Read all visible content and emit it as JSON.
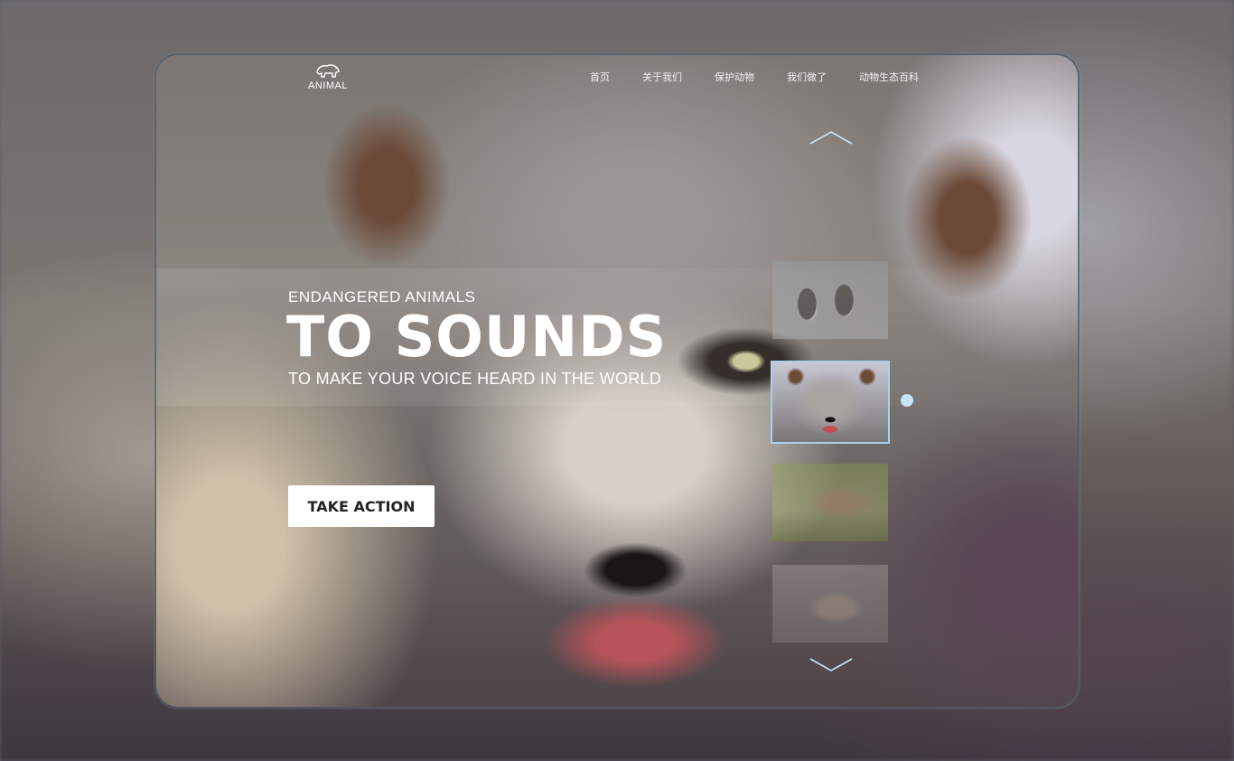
{
  "brand": {
    "name": "ANIMAL"
  },
  "nav": [
    {
      "label": "首页"
    },
    {
      "label": "关于我们"
    },
    {
      "label": "保护动物"
    },
    {
      "label": "我们做了"
    },
    {
      "label": "动物生态百科"
    }
  ],
  "hero": {
    "eyebrow": "ENDANGERED ANIMALS",
    "title": "TO SOUNDS",
    "tagline": "TO MAKE YOUR VOICE HEARD IN THE WORLD",
    "cta_label": "TAKE ACTION"
  },
  "carousel": {
    "thumbnails": [
      {
        "name": "penguin",
        "active": false
      },
      {
        "name": "wolf",
        "active": true
      },
      {
        "name": "lion",
        "active": false
      },
      {
        "name": "bear",
        "active": false
      }
    ],
    "up_icon": "chevron-up-icon",
    "down_icon": "chevron-down-icon",
    "indicator_color": "#c6e4f8",
    "active_border_color": "#a9d2ef"
  }
}
